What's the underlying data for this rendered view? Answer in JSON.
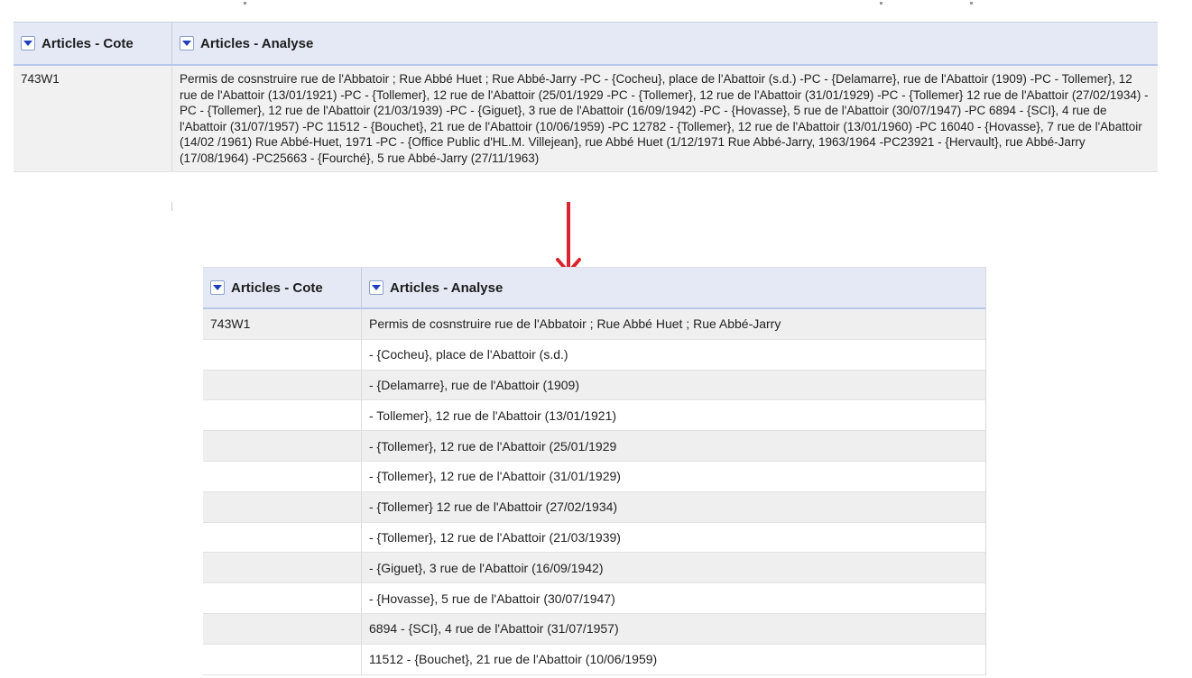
{
  "top_grid": {
    "columns": [
      "Articles - Cote",
      "Articles - Analyse"
    ],
    "row": {
      "cote": "743W1",
      "analyse": "Permis de cosnstruire rue de l'Abbatoir ; Rue Abbé Huet ; Rue Abbé-Jarry -PC - {Cocheu}, place de l'Abattoir (s.d.) -PC - {Delamarre}, rue de l'Abattoir (1909) -PC - Tollemer}, 12 rue de l'Abattoir (13/01/1921) -PC - {Tollemer}, 12 rue de l'Abattoir (25/01/1929 -PC - {Tollemer}, 12 rue de l'Abattoir (31/01/1929) -PC - {Tollemer} 12 rue de l'Abattoir (27/02/1934) -PC - {Tollemer}, 12 rue de l'Abattoir (21/03/1939) -PC - {Giguet}, 3 rue de l'Abattoir (16/09/1942) -PC - {Hovasse}, 5 rue de l'Abattoir (30/07/1947) -PC 6894 - {SCI}, 4 rue de l'Abattoir (31/07/1957) -PC 11512 - {Bouchet}, 21 rue de l'Abattoir (10/06/1959) -PC 12782 - {Tollemer}, 12 rue de l'Abattoir (13/01/1960) -PC 16040 - {Hovasse}, 7 rue de l'Abattoir (14/02 /1961) Rue Abbé-Huet, 1971 -PC - {Office Public d'HL.M. Villejean}, rue Abbé Huet (1/12/1971 Rue Abbé-Jarry, 1963/1964 -PC23921 - {Hervault}, rue Abbé-Jarry (17/08/1964) -PC25663 - {Fourché}, 5 rue Abbé-Jarry (27/11/1963)"
    }
  },
  "bottom_grid": {
    "columns": [
      "Articles - Cote",
      "Articles - Analyse"
    ],
    "rows": [
      {
        "cote": "743W1",
        "analyse": "Permis de cosnstruire rue de l'Abbatoir ; Rue Abbé Huet ; Rue Abbé-Jarry"
      },
      {
        "cote": "",
        "analyse": "- {Cocheu}, place de l'Abattoir (s.d.)"
      },
      {
        "cote": "",
        "analyse": "- {Delamarre}, rue de l'Abattoir (1909)"
      },
      {
        "cote": "",
        "analyse": "- Tollemer}, 12 rue de l'Abattoir (13/01/1921)"
      },
      {
        "cote": "",
        "analyse": "- {Tollemer}, 12 rue de l'Abattoir (25/01/1929"
      },
      {
        "cote": "",
        "analyse": "- {Tollemer}, 12 rue de l'Abattoir (31/01/1929)"
      },
      {
        "cote": "",
        "analyse": "- {Tollemer} 12 rue de l'Abattoir (27/02/1934)"
      },
      {
        "cote": "",
        "analyse": "- {Tollemer}, 12 rue de l'Abattoir (21/03/1939)"
      },
      {
        "cote": "",
        "analyse": "- {Giguet}, 3 rue de l'Abattoir (16/09/1942)"
      },
      {
        "cote": "",
        "analyse": "- {Hovasse}, 5 rue de l'Abattoir (30/07/1947)"
      },
      {
        "cote": "",
        "analyse": "6894 - {SCI}, 4 rue de l'Abattoir (31/07/1957)"
      },
      {
        "cote": "",
        "analyse": "11512 - {Bouchet}, 21 rue de l'Abattoir (10/06/1959)"
      }
    ]
  },
  "icons": {
    "column_menu": "dropdown-arrow-icon",
    "transform_arrow": "arrow-down-icon"
  },
  "colors": {
    "header_bg": "#e4e9f5",
    "dropdown_arrow": "#1f3fbf",
    "arrow": "#d9232e",
    "row_alt": "#efefef"
  }
}
